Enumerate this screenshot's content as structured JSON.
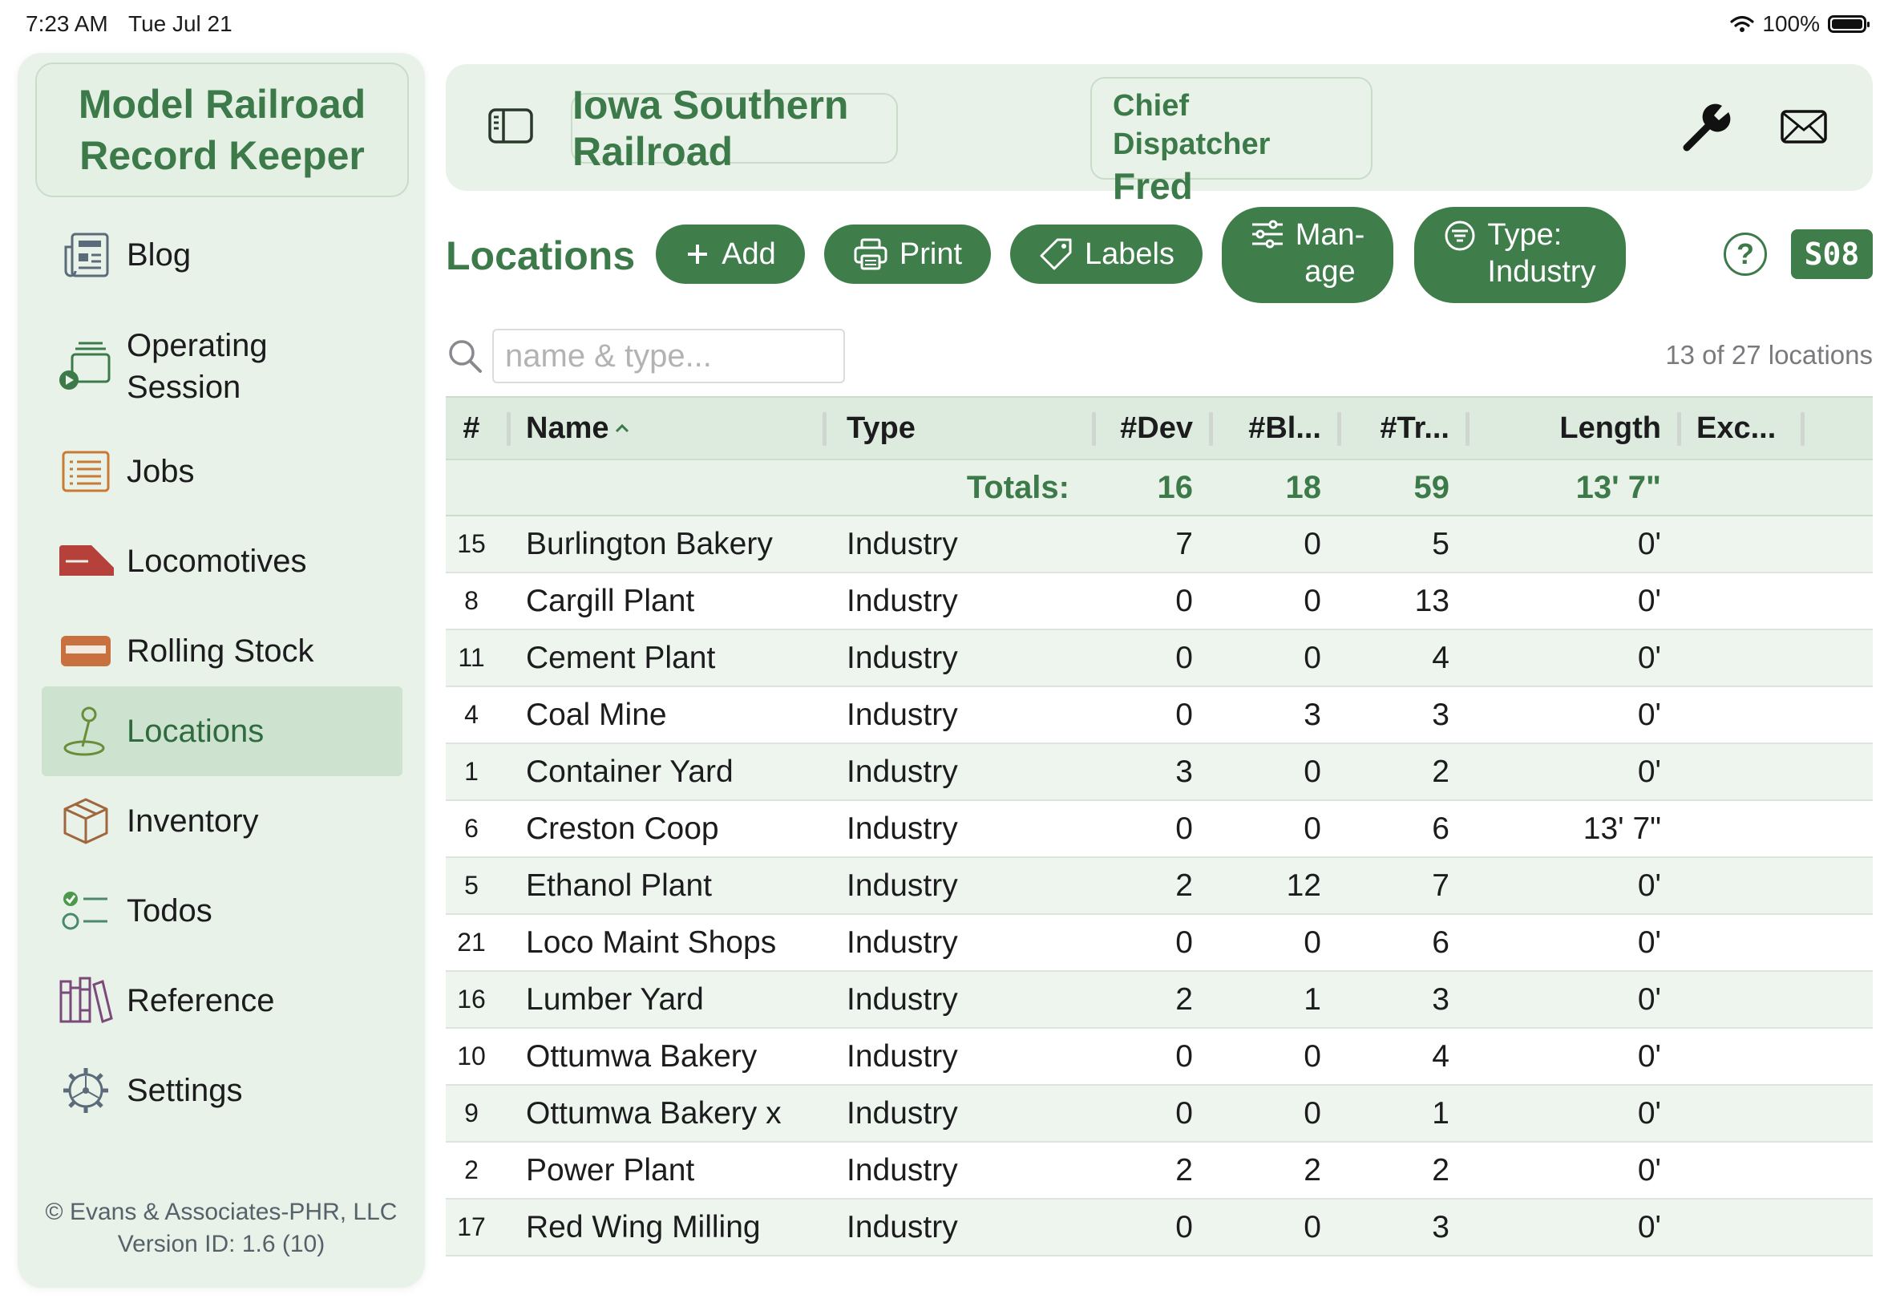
{
  "status_bar": {
    "time": "7:23 AM",
    "date": "Tue Jul 21",
    "battery": "100%"
  },
  "sidebar": {
    "app_title_line1": "Model Railroad",
    "app_title_line2": "Record Keeper",
    "items": [
      {
        "label": "Blog",
        "icon": "newspaper-icon"
      },
      {
        "label": "Operating\nSession",
        "icon": "operating-session-icon"
      },
      {
        "label": "Jobs",
        "icon": "list-icon"
      },
      {
        "label": "Locomotives",
        "icon": "locomotive-icon"
      },
      {
        "label": "Rolling Stock",
        "icon": "railcar-icon"
      },
      {
        "label": "Locations",
        "icon": "location-pin-icon",
        "active": true
      },
      {
        "label": "Inventory",
        "icon": "box-icon"
      },
      {
        "label": "Todos",
        "icon": "checklist-icon"
      },
      {
        "label": "Reference",
        "icon": "books-icon"
      },
      {
        "label": "Settings",
        "icon": "gear-icon"
      }
    ],
    "footer_line1": "© Evans & Associates-PHR, LLC",
    "footer_line2": "Version ID: 1.6 (10)"
  },
  "header": {
    "railroad": "Iowa Southern Railroad",
    "user_role": "Chief Dispatcher",
    "user_name": "Fred"
  },
  "toolbar": {
    "title": "Locations",
    "add": "Add",
    "print": "Print",
    "labels": "Labels",
    "manage_line1": "Man-",
    "manage_line2": "age",
    "filter_line1": "Type:",
    "filter_line2": "Industry",
    "help": "?",
    "session": "S08"
  },
  "search": {
    "placeholder": "name & type...",
    "value": "",
    "count": "13 of 27 locations"
  },
  "table": {
    "columns": {
      "num": "#",
      "name": "Name",
      "type": "Type",
      "dev": "#Dev",
      "blocks": "#Bl...",
      "tracks": "#Tr...",
      "length": "Length",
      "exc": "Exc..."
    },
    "totals": {
      "label": "Totals:",
      "dev": "16",
      "blocks": "18",
      "tracks": "59",
      "length": "13' 7\""
    },
    "rows": [
      {
        "num": "15",
        "name": "Burlington Bakery",
        "type": "Industry",
        "dev": "7",
        "blocks": "0",
        "tracks": "5",
        "length": "0'"
      },
      {
        "num": "8",
        "name": "Cargill Plant",
        "type": "Industry",
        "dev": "0",
        "blocks": "0",
        "tracks": "13",
        "length": "0'"
      },
      {
        "num": "11",
        "name": "Cement Plant",
        "type": "Industry",
        "dev": "0",
        "blocks": "0",
        "tracks": "4",
        "length": "0'"
      },
      {
        "num": "4",
        "name": "Coal Mine",
        "type": "Industry",
        "dev": "0",
        "blocks": "3",
        "tracks": "3",
        "length": "0'"
      },
      {
        "num": "1",
        "name": "Container Yard",
        "type": "Industry",
        "dev": "3",
        "blocks": "0",
        "tracks": "2",
        "length": "0'"
      },
      {
        "num": "6",
        "name": "Creston Coop",
        "type": "Industry",
        "dev": "0",
        "blocks": "0",
        "tracks": "6",
        "length": "13' 7\""
      },
      {
        "num": "5",
        "name": "Ethanol Plant",
        "type": "Industry",
        "dev": "2",
        "blocks": "12",
        "tracks": "7",
        "length": "0'"
      },
      {
        "num": "21",
        "name": "Loco Maint Shops",
        "type": "Industry",
        "dev": "0",
        "blocks": "0",
        "tracks": "6",
        "length": "0'"
      },
      {
        "num": "16",
        "name": "Lumber Yard",
        "type": "Industry",
        "dev": "2",
        "blocks": "1",
        "tracks": "3",
        "length": "0'"
      },
      {
        "num": "10",
        "name": "Ottumwa Bakery",
        "type": "Industry",
        "dev": "0",
        "blocks": "0",
        "tracks": "4",
        "length": "0'"
      },
      {
        "num": "9",
        "name": "Ottumwa Bakery x",
        "type": "Industry",
        "dev": "0",
        "blocks": "0",
        "tracks": "1",
        "length": "0'"
      },
      {
        "num": "2",
        "name": "Power Plant",
        "type": "Industry",
        "dev": "2",
        "blocks": "2",
        "tracks": "2",
        "length": "0'"
      },
      {
        "num": "17",
        "name": "Red Wing Milling",
        "type": "Industry",
        "dev": "0",
        "blocks": "0",
        "tracks": "3",
        "length": "0'"
      }
    ]
  },
  "colors": {
    "accent": "#3f7d4b",
    "sidebar_bg": "#e8f2e8",
    "header_row": "#dcebdd",
    "active_item": "#cde3d0"
  }
}
